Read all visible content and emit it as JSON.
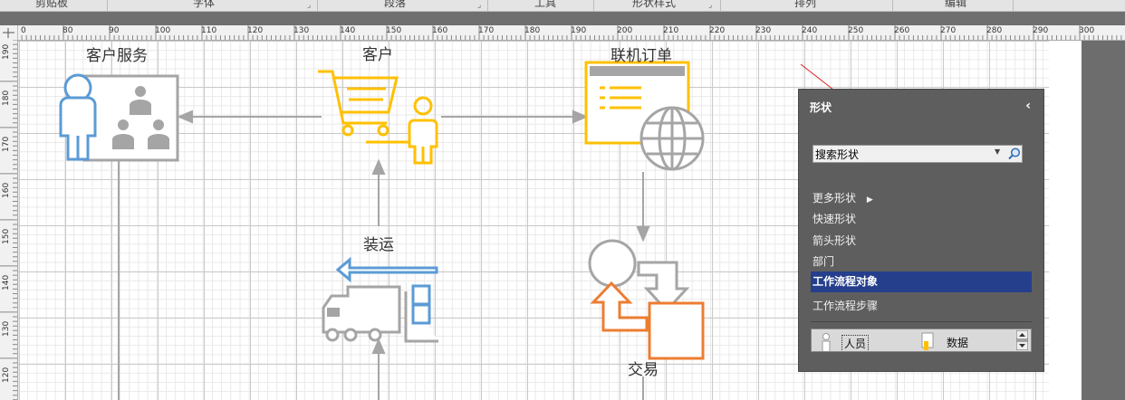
{
  "ribbon": {
    "groups": [
      "剪贴板",
      "字体",
      "段落",
      "工具",
      "形状样式",
      "排列",
      "编辑"
    ]
  },
  "ruler": {
    "horizontal_ticks": [
      "0",
      "80",
      "90",
      "100",
      "110",
      "120",
      "130",
      "140",
      "150",
      "160",
      "170",
      "180",
      "190",
      "200",
      "210",
      "220",
      "230",
      "240",
      "250",
      "260",
      "270",
      "280",
      "290",
      "300"
    ],
    "vertical_ticks": [
      "190",
      "180",
      "170",
      "160",
      "150",
      "140",
      "130",
      "120"
    ]
  },
  "diagram": {
    "labels": {
      "customer_service": "客户服务",
      "customer": "客户",
      "online_order": "联机订单",
      "shipping": "装运",
      "transaction": "交易"
    },
    "colors": {
      "blue": "#5b9bd5",
      "orange": "#ed7d31",
      "gold": "#ffc000",
      "gray": "#a5a5a5",
      "arrow_red": "#e02020"
    }
  },
  "shapes_pane": {
    "title": "形状",
    "collapse_icon": "chevron-left",
    "search": {
      "value": "搜索形状",
      "placeholder": "搜索形状"
    },
    "nav": [
      {
        "label": "更多形状",
        "has_submenu": true
      },
      {
        "label": "快速形状"
      },
      {
        "label": "箭头形状"
      },
      {
        "label": "部门"
      },
      {
        "label": "工作流程对象",
        "selected": true
      },
      {
        "label": "工作流程步骤"
      }
    ],
    "stencil_items": [
      "人员",
      "数据"
    ]
  }
}
